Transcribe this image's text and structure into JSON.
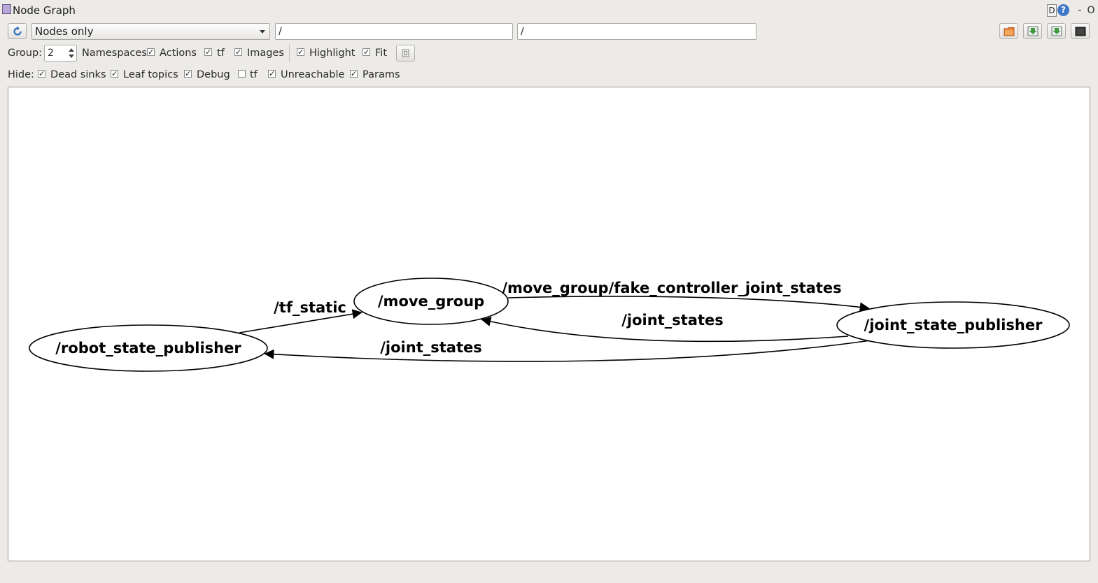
{
  "window": {
    "title": "Node Graph",
    "d_label": "D",
    "help_label": "?",
    "minimize_label": "-",
    "close_label": "O"
  },
  "toolbar": {
    "graph_type": "Nodes only",
    "node_filter": "/",
    "topic_filter": "/"
  },
  "options": {
    "group_label": "Group:",
    "group_value": "2",
    "items": [
      {
        "label": "Namespaces"
      },
      {
        "label": "Actions",
        "checked": true
      },
      {
        "label": "tf",
        "checked": true
      },
      {
        "label": "Images",
        "checked": true
      },
      {
        "label": "Highlight",
        "checked": true
      },
      {
        "label": "Fit",
        "checked": true
      }
    ]
  },
  "hide": {
    "label": "Hide:",
    "items": [
      {
        "label": "Dead sinks",
        "checked": true
      },
      {
        "label": "Leaf topics",
        "checked": true
      },
      {
        "label": "Debug",
        "checked": true
      },
      {
        "label": "tf",
        "checked": false
      },
      {
        "label": "Unreachable",
        "checked": true
      },
      {
        "label": "Params",
        "checked": true
      }
    ]
  },
  "graph": {
    "nodes": [
      {
        "name": "/robot_state_publisher"
      },
      {
        "name": "/move_group"
      },
      {
        "name": "/joint_state_publisher"
      }
    ],
    "edges": [
      {
        "label": "/tf_static",
        "from": "/robot_state_publisher",
        "to": "/move_group"
      },
      {
        "label": "/move_group/fake_controller_joint_states",
        "from": "/move_group",
        "to": "/joint_state_publisher"
      },
      {
        "label": "/joint_states",
        "from": "/joint_state_publisher",
        "to": "/move_group"
      },
      {
        "label": "/joint_states",
        "from": "/joint_state_publisher",
        "to": "/robot_state_publisher"
      }
    ]
  }
}
